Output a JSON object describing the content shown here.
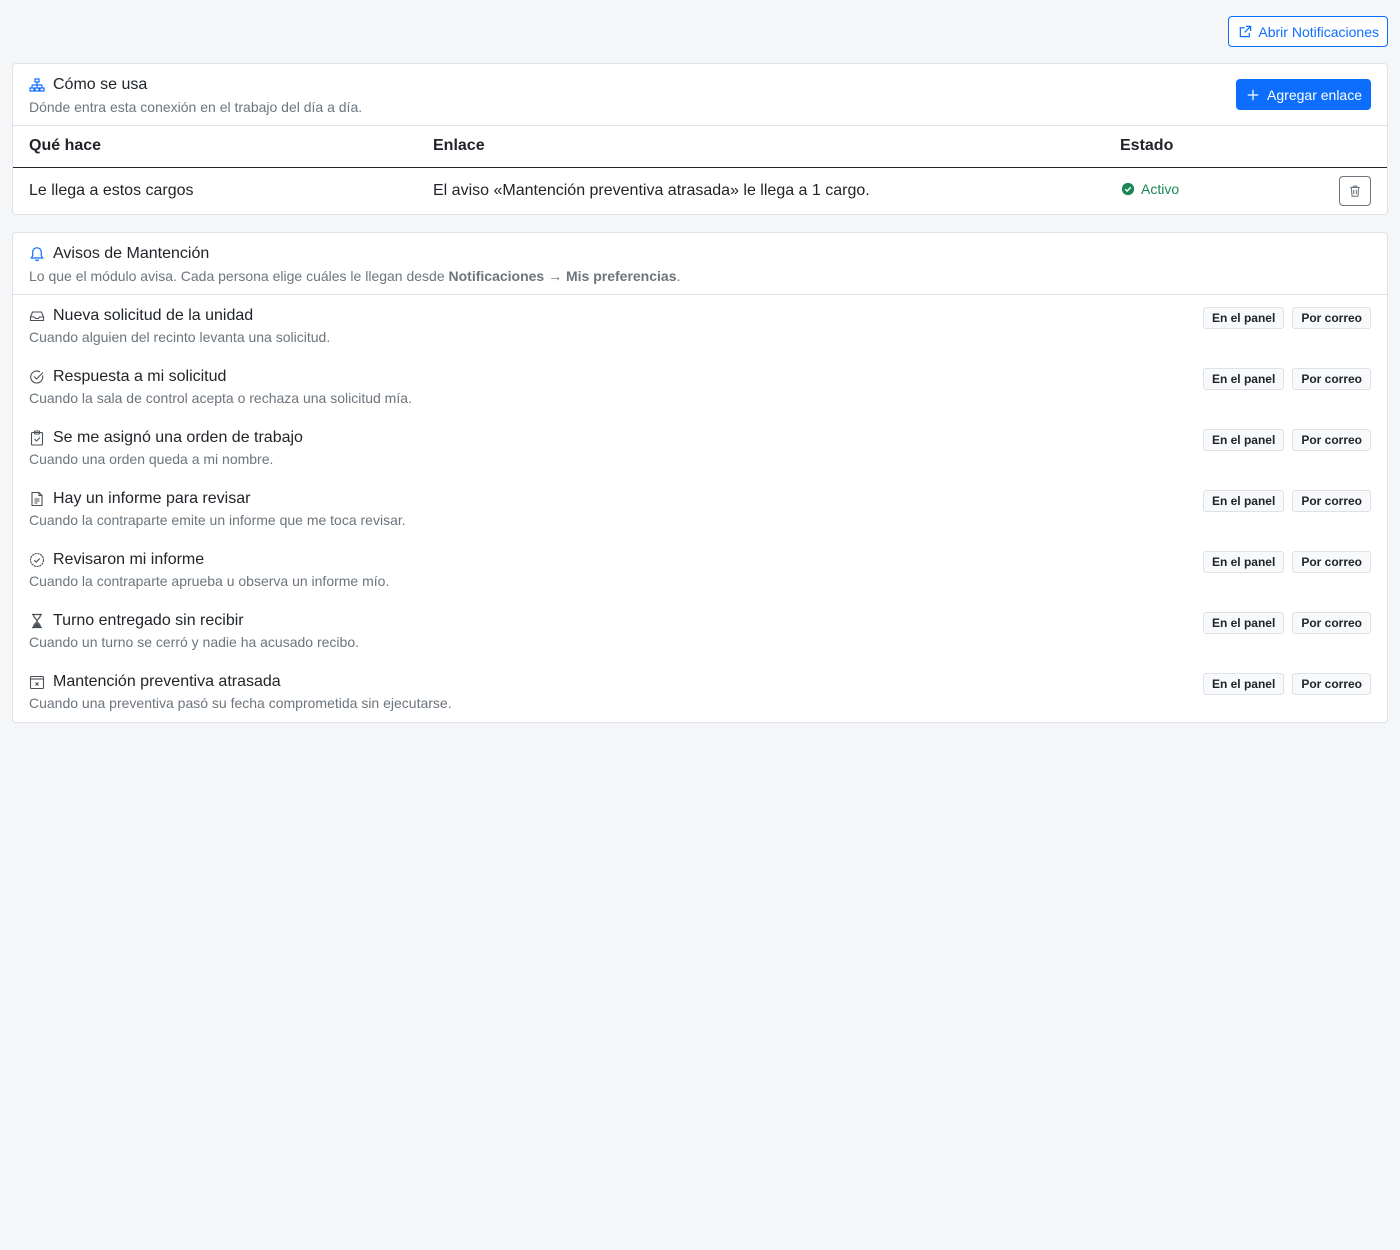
{
  "header": {
    "open_notifications_label": "Abrir Notificaciones"
  },
  "usage_card": {
    "title": "Cómo se usa",
    "subtitle": "Dónde entra esta conexión en el trabajo del día a día.",
    "add_link_label": "Agregar enlace",
    "columns": [
      "Qué hace",
      "Enlace",
      "Estado"
    ],
    "rows": [
      {
        "what": "Le llega a estos cargos",
        "link": "El aviso «Mantención preventiva atrasada» le llega a 1 cargo.",
        "status": "Activo"
      }
    ]
  },
  "avisos_card": {
    "title": "Avisos de Mantención",
    "subtitle_prefix": "Lo que el módulo avisa. Cada persona elige cuáles le llegan desde ",
    "subtitle_bold": "Notificaciones → Mis preferencias",
    "subtitle_suffix": ".",
    "badge_panel": "En el panel",
    "badge_email": "Por correo",
    "items": [
      {
        "icon": "inbox-icon",
        "title": "Nueva solicitud de la unidad",
        "desc": "Cuando alguien del recinto levanta una solicitud."
      },
      {
        "icon": "check-circle-icon",
        "title": "Respuesta a mi solicitud",
        "desc": "Cuando la sala de control acepta o rechaza una solicitud mía."
      },
      {
        "icon": "clipboard-check-icon",
        "title": "Se me asignó una orden de trabajo",
        "desc": "Cuando una orden queda a mi nombre."
      },
      {
        "icon": "file-text-icon",
        "title": "Hay un informe para revisar",
        "desc": "Cuando la contraparte emite un informe que me toca revisar."
      },
      {
        "icon": "patch-check-icon",
        "title": "Revisaron mi informe",
        "desc": "Cuando la contraparte aprueba u observa un informe mío."
      },
      {
        "icon": "hourglass-icon",
        "title": "Turno entregado sin recibir",
        "desc": "Cuando un turno se cerró y nadie ha acusado recibo."
      },
      {
        "icon": "calendar-x-icon",
        "title": "Mantención preventiva atrasada",
        "desc": "Cuando una preventiva pasó su fecha comprometida sin ejecutarse."
      }
    ]
  },
  "colors": {
    "primary": "#0d6efd",
    "success": "#198754",
    "muted": "#6c757d",
    "background": "#f5f6f8"
  }
}
